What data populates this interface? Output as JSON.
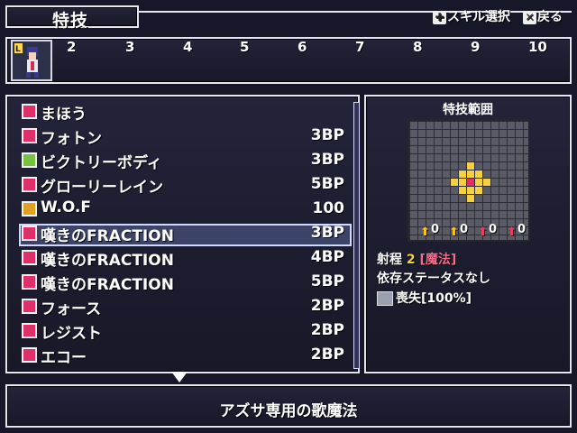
{
  "header": {
    "title": "特技"
  },
  "hints": {
    "skill_select": "スキル選択",
    "back": "戻る"
  },
  "party": {
    "slot_numbers": [
      "2",
      "3",
      "4",
      "5",
      "6",
      "7",
      "8",
      "9",
      "10"
    ]
  },
  "skills": [
    {
      "name": "まほう",
      "cost": "",
      "icon_color": "#e0306a",
      "icon": "music-note-icon"
    },
    {
      "name": "フォトン",
      "cost": "3BP",
      "icon_color": "#e0306a",
      "icon": "square-skill-icon"
    },
    {
      "name": "ビクトリーボディ",
      "cost": "3BP",
      "icon_color": "#7ac043",
      "icon": "plus-skill-icon"
    },
    {
      "name": "グローリーレイン",
      "cost": "5BP",
      "icon_color": "#e0306a",
      "icon": "square-skill-icon"
    },
    {
      "name": "W.O.F",
      "cost": "100",
      "icon_color": "#e0a020",
      "icon": "gear-skill-icon"
    },
    {
      "name": "嘆きのFRACTION",
      "cost": "3BP",
      "icon_color": "#e0306a",
      "icon": "music-note-icon"
    },
    {
      "name": "嘆きのFRACTION",
      "cost": "4BP",
      "icon_color": "#e0306a",
      "icon": "music-note-icon"
    },
    {
      "name": "嘆きのFRACTION",
      "cost": "5BP",
      "icon_color": "#e0306a",
      "icon": "music-note-icon"
    },
    {
      "name": "フォース",
      "cost": "2BP",
      "icon_color": "#e0306a",
      "icon": "vo-icon"
    },
    {
      "name": "レジスト",
      "cost": "2BP",
      "icon_color": "#e0306a",
      "icon": "vo-icon"
    },
    {
      "name": "エコー",
      "cost": "2BP",
      "icon_color": "#e0306a",
      "icon": "vo-icon"
    }
  ],
  "selected_index": 5,
  "detail": {
    "range_title": "特技範囲",
    "bonuses": [
      "0",
      "0",
      "0",
      "0"
    ],
    "range_label": "射程",
    "range_value": "2",
    "range_type": "[魔法]",
    "status_dep": "依存ステータスなし",
    "effect": "喪失[100%]"
  },
  "description": "アズサ専用の歌魔法",
  "colors": {
    "highlight": "#f0d020",
    "accent_pink": "#e0306a",
    "yellow": "#f5d040"
  }
}
